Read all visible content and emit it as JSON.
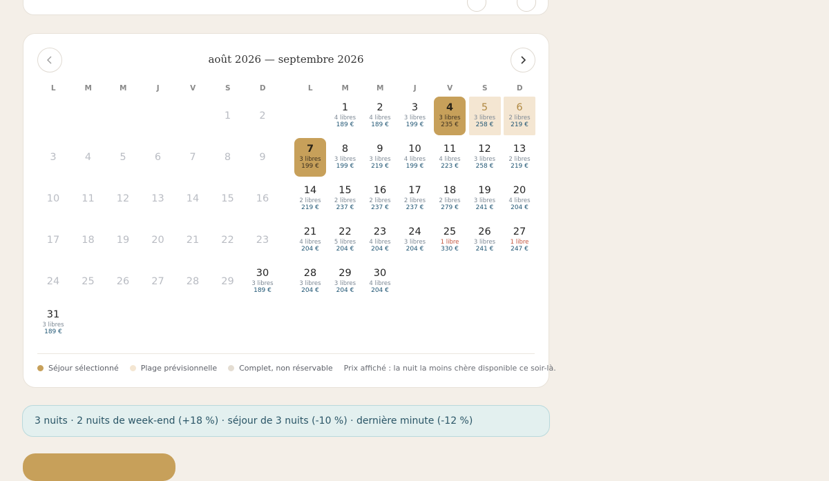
{
  "calendar": {
    "title": "août 2026 — septembre 2026",
    "weekdays": [
      "L",
      "M",
      "M",
      "J",
      "V",
      "S",
      "D"
    ],
    "months": [
      {
        "name": "août 2026",
        "days": [
          {
            "d": "",
            "state": "empty"
          },
          {
            "d": "",
            "state": "empty"
          },
          {
            "d": "",
            "state": "empty"
          },
          {
            "d": "",
            "state": "empty"
          },
          {
            "d": "",
            "state": "empty"
          },
          {
            "d": "1",
            "state": "past"
          },
          {
            "d": "2",
            "state": "past"
          },
          {
            "d": "3",
            "state": "past"
          },
          {
            "d": "4",
            "state": "past"
          },
          {
            "d": "5",
            "state": "past"
          },
          {
            "d": "6",
            "state": "past"
          },
          {
            "d": "7",
            "state": "past"
          },
          {
            "d": "8",
            "state": "past"
          },
          {
            "d": "9",
            "state": "past"
          },
          {
            "d": "10",
            "state": "past"
          },
          {
            "d": "11",
            "state": "past"
          },
          {
            "d": "12",
            "state": "past"
          },
          {
            "d": "13",
            "state": "past"
          },
          {
            "d": "14",
            "state": "past"
          },
          {
            "d": "15",
            "state": "past"
          },
          {
            "d": "16",
            "state": "past"
          },
          {
            "d": "17",
            "state": "past"
          },
          {
            "d": "18",
            "state": "past"
          },
          {
            "d": "19",
            "state": "past"
          },
          {
            "d": "20",
            "state": "past"
          },
          {
            "d": "21",
            "state": "past"
          },
          {
            "d": "22",
            "state": "past"
          },
          {
            "d": "23",
            "state": "past"
          },
          {
            "d": "24",
            "state": "past"
          },
          {
            "d": "25",
            "state": "past"
          },
          {
            "d": "26",
            "state": "past"
          },
          {
            "d": "27",
            "state": "past"
          },
          {
            "d": "28",
            "state": "past"
          },
          {
            "d": "29",
            "state": "past"
          },
          {
            "d": "30",
            "state": "avail",
            "avail": "3 libres",
            "price": "189 €"
          },
          {
            "d": "31",
            "state": "avail",
            "avail": "3 libres",
            "price": "189 €"
          }
        ]
      },
      {
        "name": "septembre 2026",
        "days": [
          {
            "d": "",
            "state": "empty"
          },
          {
            "d": "1",
            "state": "avail",
            "avail": "4 libres",
            "price": "189 €"
          },
          {
            "d": "2",
            "state": "avail",
            "avail": "4 libres",
            "price": "189 €"
          },
          {
            "d": "3",
            "state": "avail",
            "avail": "3 libres",
            "price": "199 €"
          },
          {
            "d": "4",
            "state": "selected",
            "edge": "both",
            "avail": "3 libres",
            "price": "235 €"
          },
          {
            "d": "5",
            "state": "tentative",
            "avail": "3 libres",
            "price": "258 €"
          },
          {
            "d": "6",
            "state": "tentative",
            "avail": "2 libres",
            "price": "219 €"
          },
          {
            "d": "7",
            "state": "selected",
            "edge": "both",
            "avail": "3 libres",
            "price": "199 €"
          },
          {
            "d": "8",
            "state": "avail",
            "avail": "3 libres",
            "price": "199 €"
          },
          {
            "d": "9",
            "state": "avail",
            "avail": "3 libres",
            "price": "219 €"
          },
          {
            "d": "10",
            "state": "avail",
            "avail": "4 libres",
            "price": "199 €"
          },
          {
            "d": "11",
            "state": "avail",
            "avail": "4 libres",
            "price": "223 €"
          },
          {
            "d": "12",
            "state": "avail",
            "avail": "3 libres",
            "price": "258 €"
          },
          {
            "d": "13",
            "state": "avail",
            "avail": "2 libres",
            "price": "219 €"
          },
          {
            "d": "14",
            "state": "avail",
            "avail": "2 libres",
            "price": "219 €"
          },
          {
            "d": "15",
            "state": "avail",
            "avail": "2 libres",
            "price": "237 €"
          },
          {
            "d": "16",
            "state": "avail",
            "avail": "2 libres",
            "price": "237 €"
          },
          {
            "d": "17",
            "state": "avail",
            "avail": "2 libres",
            "price": "237 €"
          },
          {
            "d": "18",
            "state": "avail",
            "avail": "2 libres",
            "price": "279 €"
          },
          {
            "d": "19",
            "state": "avail",
            "avail": "3 libres",
            "price": "241 €"
          },
          {
            "d": "20",
            "state": "avail",
            "avail": "4 libres",
            "price": "204 €"
          },
          {
            "d": "21",
            "state": "avail",
            "avail": "4 libres",
            "price": "204 €"
          },
          {
            "d": "22",
            "state": "avail",
            "avail": "5 libres",
            "price": "204 €"
          },
          {
            "d": "23",
            "state": "avail",
            "avail": "4 libres",
            "price": "204 €"
          },
          {
            "d": "24",
            "state": "avail",
            "avail": "3 libres",
            "price": "204 €"
          },
          {
            "d": "25",
            "state": "avail",
            "avail": "1 libre",
            "low": true,
            "price": "330 €"
          },
          {
            "d": "26",
            "state": "avail",
            "avail": "3 libres",
            "price": "241 €"
          },
          {
            "d": "27",
            "state": "avail",
            "avail": "1 libre",
            "low": true,
            "price": "247 €"
          },
          {
            "d": "28",
            "state": "avail",
            "avail": "3 libres",
            "price": "204 €"
          },
          {
            "d": "29",
            "state": "avail",
            "avail": "3 libres",
            "price": "204 €"
          },
          {
            "d": "30",
            "state": "avail",
            "avail": "4 libres",
            "price": "204 €"
          }
        ]
      }
    ]
  },
  "legend": {
    "items": [
      {
        "label": "Séjour sélectionné",
        "color": "#c7a05a"
      },
      {
        "label": "Plage prévisionnelle",
        "color": "#f4e6d2"
      },
      {
        "label": "Complet, non réservable",
        "color": "#e4ddd2"
      }
    ],
    "note": "Prix affiché : la nuit la moins chère disponible ce soir-là."
  },
  "summary": {
    "text": "3 nuits · 2 nuits de week-end (+18 %) · séjour de 3 nuits (-10 %) · dernière minute (-12 %)"
  },
  "icons": {
    "prev": "chevron-left-icon",
    "next": "chevron-right-icon"
  }
}
